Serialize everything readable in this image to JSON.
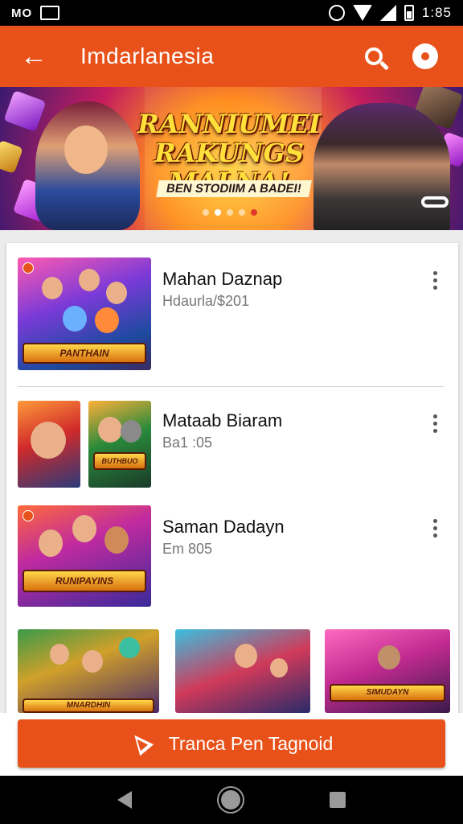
{
  "status_bar": {
    "left_text": "ΜΟ",
    "time": "1:85",
    "icons": [
      "notification-icon",
      "image-icon",
      "alarm-icon",
      "wifi-icon",
      "signal-icon",
      "battery-icon"
    ]
  },
  "app_bar": {
    "title": "Imdarlanesia",
    "icons": [
      "back-arrow-icon",
      "search-icon",
      "gear-icon"
    ],
    "color": "#e8521a"
  },
  "banner": {
    "title_line1": "RANNIUMEI",
    "title_line2": "RAKUNGS MALNA!",
    "subtitle": "BEN STODIIM A BADEI!",
    "page_count": 5,
    "active_page": 2
  },
  "list": {
    "items": [
      {
        "title": "Mahan Daznap",
        "subtitle": "Hdaurla/$201"
      },
      {
        "title": "Mataab Biaram",
        "subtitle": "Ba1 :05"
      },
      {
        "title": "Saman Dadayn",
        "subtitle": "Em 805"
      }
    ],
    "thumb_labels": [
      "PANTHAIN",
      "BUTHBUO",
      "RUNIPAYINS",
      "MNARDHIN",
      "SIMUDAYN"
    ]
  },
  "cta": {
    "label": "Tranca Pen Tagnoid",
    "icon": "cursor-click-icon"
  },
  "nav_bar": {
    "icons": [
      "nav-back-icon",
      "nav-home-icon",
      "nav-recents-icon"
    ]
  }
}
